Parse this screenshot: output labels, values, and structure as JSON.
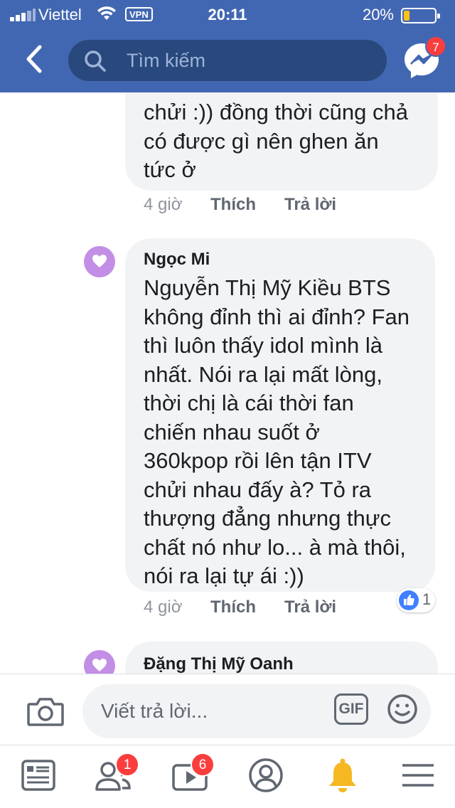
{
  "status_bar": {
    "carrier": "Viettel",
    "vpn": "VPN",
    "time": "20:11",
    "battery_percent": "20%",
    "battery_level": 0.2
  },
  "header": {
    "search_placeholder": "Tìm kiếm",
    "messenger_badge": "7"
  },
  "comments": [
    {
      "author": "",
      "text": "chửi :)) đồng thời cũng chả\ncó được gì nên ghen ăn\ntức ở",
      "time": "4 giờ",
      "like_label": "Thích",
      "reply_label": "Trả lời"
    },
    {
      "author": "Ngọc Mi",
      "text": "Nguyễn Thị Mỹ Kiều BTS\nkhông đỉnh thì ai đỉnh? Fan\nthì luôn thấy idol mình là\nnhất. Nói ra lại mất lòng,\nthời chị là cái thời fan\nchiến nhau suốt ở\n360kpop rồi lên tận ITV\nchửi nhau đấy à? Tỏ ra\nthượng đẳng nhưng thực\nchất nó như lo... à mà thôi,\nnói ra lại tự ái :))",
      "time": "4 giờ",
      "like_label": "Thích",
      "reply_label": "Trả lời",
      "reaction_count": "1"
    },
    {
      "author": "Đặng Thị Mỹ Oanh",
      "text": ""
    }
  ],
  "reply_bar": {
    "placeholder": "Viết trả lời...",
    "gif_label": "GIF"
  },
  "tabbar": {
    "friends_badge": "1",
    "watch_badge": "6",
    "active_tab": "notifications"
  },
  "colors": {
    "brand_blue": "#4267b2",
    "search_bg": "#29487d",
    "bubble_bg": "#f2f3f5",
    "badge_red": "#fa3e3e",
    "bell_yellow": "#f5b822",
    "avatar_purple": "#c38ee6"
  }
}
